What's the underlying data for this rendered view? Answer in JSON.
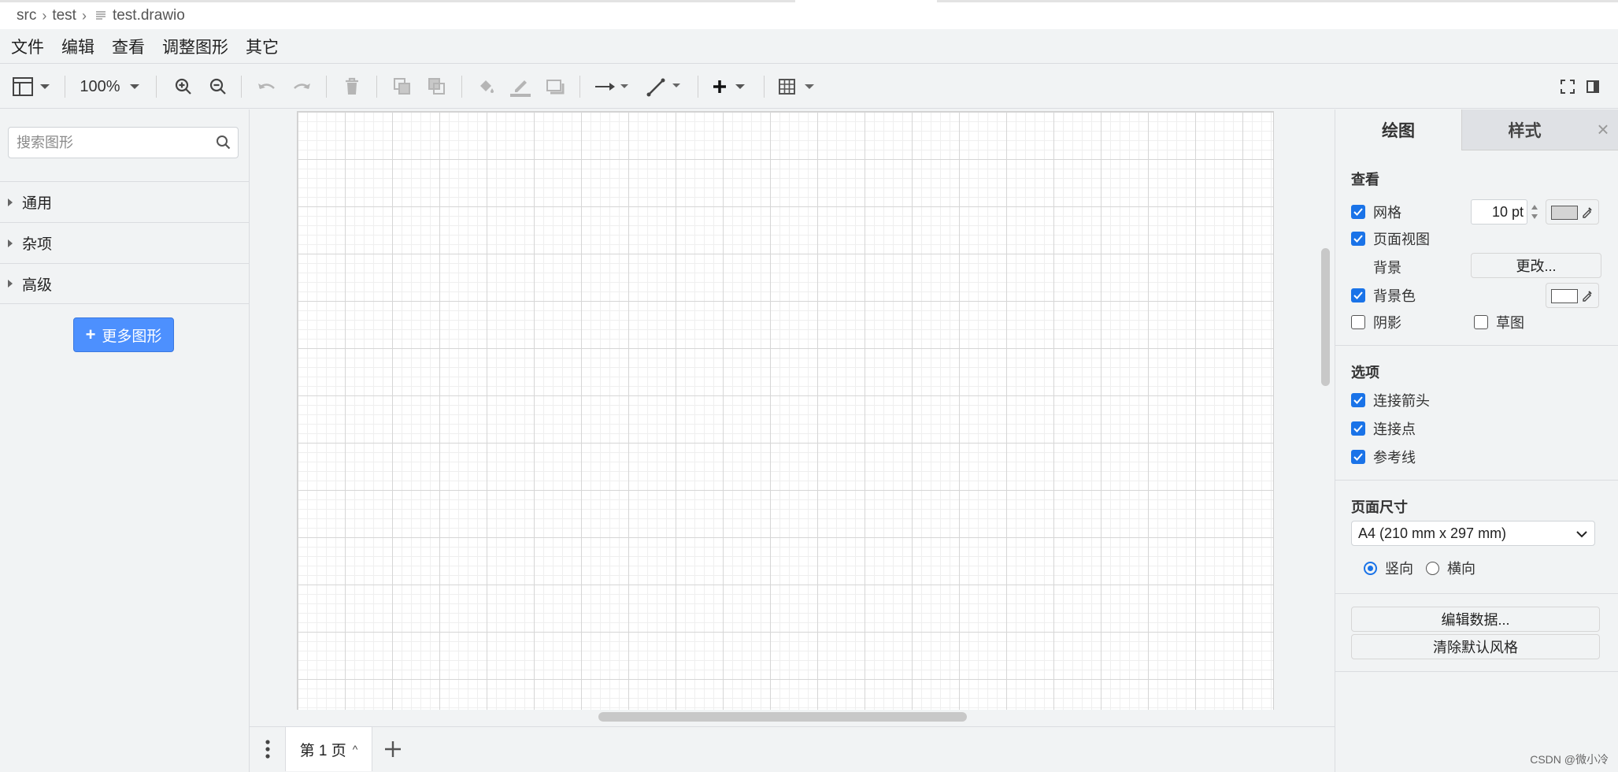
{
  "breadcrumb": {
    "items": [
      "src",
      "test",
      "test.drawio"
    ]
  },
  "menu": [
    "文件",
    "编辑",
    "查看",
    "调整图形",
    "其它"
  ],
  "toolbar": {
    "zoom": "100%"
  },
  "sidebar": {
    "search_placeholder": "搜索图形",
    "sections": [
      "通用",
      "杂项",
      "高级"
    ],
    "more_shapes": "更多图形"
  },
  "footer": {
    "page_tab": "第 1 页"
  },
  "panel": {
    "tabs": [
      "绘图",
      "样式"
    ],
    "view": {
      "title": "查看",
      "grid": "网格",
      "grid_size": "10 pt",
      "page_view": "页面视图",
      "background": "背景",
      "change_btn": "更改...",
      "bg_color": "背景色",
      "shadow": "阴影",
      "sketch": "草图"
    },
    "options": {
      "title": "选项",
      "connection_arrows": "连接箭头",
      "connection_points": "连接点",
      "guides": "参考线"
    },
    "page_size": {
      "title": "页面尺寸",
      "selected": "A4 (210 mm x 297 mm)",
      "portrait": "竖向",
      "landscape": "横向"
    },
    "edit_data": "编辑数据...",
    "clear_style": "清除默认风格"
  },
  "watermark": "CSDN @微小冷",
  "colors": {
    "accent": "#1a73e8",
    "button_blue": "#4d90fe",
    "grid_color": "#d4d4d4"
  }
}
